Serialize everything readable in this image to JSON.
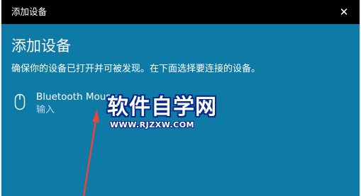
{
  "window": {
    "title": "添加设备",
    "close_glyph": "✕"
  },
  "main": {
    "heading": "添加设备",
    "description": "确保你的设备已打开并可被发现。在下面选择要连接的设备。"
  },
  "devices": [
    {
      "name": "Bluetooth Mouse",
      "type": "输入",
      "icon": "mouse-icon"
    }
  ],
  "watermark": {
    "text": "软件自学网",
    "url": "WWW.RJZXW.COM"
  },
  "colors": {
    "accent_background": "#0e7aa6",
    "titlebar": "#000000",
    "annotation_arrow": "#e8463a"
  }
}
